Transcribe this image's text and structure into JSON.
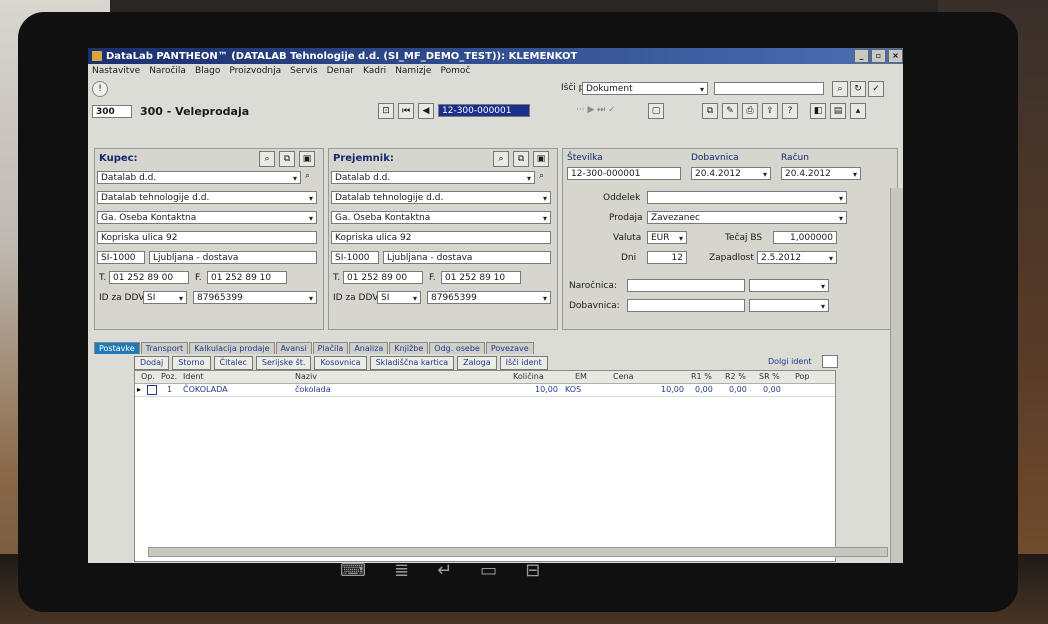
{
  "window": {
    "title": "DataLab PANTHEON™ (DATALAB Tehnologije d.d. (SI_MF_DEMO_TEST)): KLEMENKOT"
  },
  "menu": [
    "Nastavitve",
    "Naročila",
    "Blago",
    "Proizvodnja",
    "Servis",
    "Denar",
    "Kadri",
    "Namizje",
    "Pomoč"
  ],
  "search": {
    "label": "Išči po",
    "field_value": "Dokument",
    "query": ""
  },
  "doc": {
    "code": "300",
    "title": "300 - Veleprodaja",
    "number_field": "12-300-000001"
  },
  "kupec": {
    "label": "Kupec:",
    "name": "Datalab d.d.",
    "full_name": "Datalab tehnologije d.d.",
    "contact": "Ga. Oseba Kontaktna",
    "street": "Kopriska ulica 92",
    "postcode": "SI-1000",
    "city": "Ljubljana - dostava",
    "tel_label": "T.",
    "tel": "01 252 89 00",
    "fax_label": "F.",
    "fax": "01 252 89 10",
    "vat_label": "ID za DDV",
    "vat_prefix": "SI",
    "vat_number": "87965399"
  },
  "prejemnik": {
    "label": "Prejemnik:",
    "name": "Datalab d.d.",
    "full_name": "Datalab tehnologije d.d.",
    "contact": "Ga. Oseba Kontaktna",
    "street": "Kopriska ulica 92",
    "postcode": "SI-1000",
    "city": "Ljubljana - dostava",
    "tel_label": "T.",
    "tel": "01 252 89 00",
    "fax_label": "F.",
    "fax": "01 252 89 10",
    "vat_label": "ID za DDV",
    "vat_prefix": "SI",
    "vat_number": "87965399"
  },
  "header": {
    "stevilka_label": "Številka",
    "stevilka": "12-300-000001",
    "dobavnica_label": "Dobavnica",
    "dobavnica": "20.4.2012",
    "racun_label": "Račun",
    "racun": "20.4.2012",
    "oddelek_label": "Oddelek",
    "oddelek": "",
    "prodaja_label": "Prodaja",
    "prodaja": "Zavezanec",
    "valuta_label": "Valuta",
    "valuta": "EUR",
    "tecaj_label": "Tečaj BS",
    "tecaj": "1,000000",
    "dni_label": "Dni",
    "dni": "12",
    "zapadlost_label": "Zapadlost",
    "zapadlost": "2.5.2012",
    "narocnica_label": "Naročnica:",
    "dobavnica2_label": "Dobavnica:"
  },
  "tabs": [
    "Postavke",
    "Transport",
    "Kalkulacija prodaje",
    "Avansi",
    "Plačila",
    "Analiza",
    "Knjižbe",
    "Odg. osebe",
    "Povezave"
  ],
  "grid_buttons": [
    "Dodaj",
    "Storno",
    "Čitalec",
    "Serijske št.",
    "Kosovnica",
    "Skladiščna kartica",
    "Zaloga",
    "Išči ident"
  ],
  "grid_right_label": "Dolgi ident",
  "columns": [
    "Op.",
    "Poz.",
    "Ident",
    "Naziv",
    "Količina",
    "EM",
    "Cena",
    "R1 %",
    "R2 %",
    "SR %",
    "Pop"
  ],
  "rows": [
    {
      "poz": "1",
      "ident": "ČOKOLADA",
      "naziv": "čokolada",
      "kolicina": "10,00",
      "em": "KOS",
      "cena": "10,00",
      "r1": "0,00",
      "r2": "0,00",
      "sr": "0,00"
    }
  ]
}
